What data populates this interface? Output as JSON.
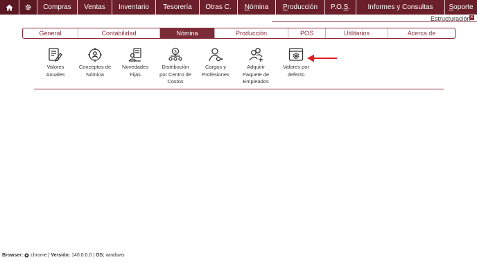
{
  "menu": {
    "items": [
      {
        "label": "Compras"
      },
      {
        "label": "Ventas"
      },
      {
        "label": "Inventario"
      },
      {
        "label": "Tesorería"
      },
      {
        "label": "Otras C."
      },
      {
        "label_pre": "",
        "label_u": "N",
        "label_post": "ómina"
      },
      {
        "label_pre": "",
        "label_u": "P",
        "label_post": "roducción"
      },
      {
        "label_pre": "P.O.",
        "label_u": "S",
        "label_post": "."
      },
      {
        "label": "Informes y Consultas"
      },
      {
        "label_pre": "",
        "label_u": "S",
        "label_post": "oporte"
      }
    ]
  },
  "header": {
    "section_title": "Estructuración",
    "close_glyph": "x"
  },
  "tabs": [
    {
      "label": "General",
      "active": false
    },
    {
      "label": "Contabilidad",
      "active": false
    },
    {
      "label": "Nómina",
      "active": true
    },
    {
      "label": "Producción",
      "active": false
    },
    {
      "label": "POS",
      "active": false
    },
    {
      "label": "Utilitarios",
      "active": false
    },
    {
      "label": "Acerca de",
      "active": false
    }
  ],
  "modules": [
    {
      "label": "Valores\nAnuales",
      "icon": "document-edit-icon"
    },
    {
      "label": "Conceptos de\nNómina",
      "icon": "target-person-icon"
    },
    {
      "label": "Novedades\nFijas",
      "icon": "person-document-icon"
    },
    {
      "label": "Distribución\npor Centro de\nCostos",
      "icon": "money-people-icon"
    },
    {
      "label": "Cargos y\nProfesiones",
      "icon": "person-key-icon"
    },
    {
      "label": "Adquirir\nPaquete de\nEmpleados",
      "icon": "add-people-icon"
    },
    {
      "label": "Valores por\ndefecto",
      "icon": "window-gear-icon"
    }
  ],
  "footer": {
    "browser_label": "Browser:",
    "browser_value": "chrome",
    "version_label": "Versión:",
    "version_value": "140.0.0.0",
    "os_label": "OS:",
    "os_value": "windows",
    "sep": "|"
  },
  "colors": {
    "menu_bg": "#6b1f2a",
    "accent": "#8c2d3a",
    "active_tab": "#7a2d37",
    "arrow": "#e02020"
  }
}
